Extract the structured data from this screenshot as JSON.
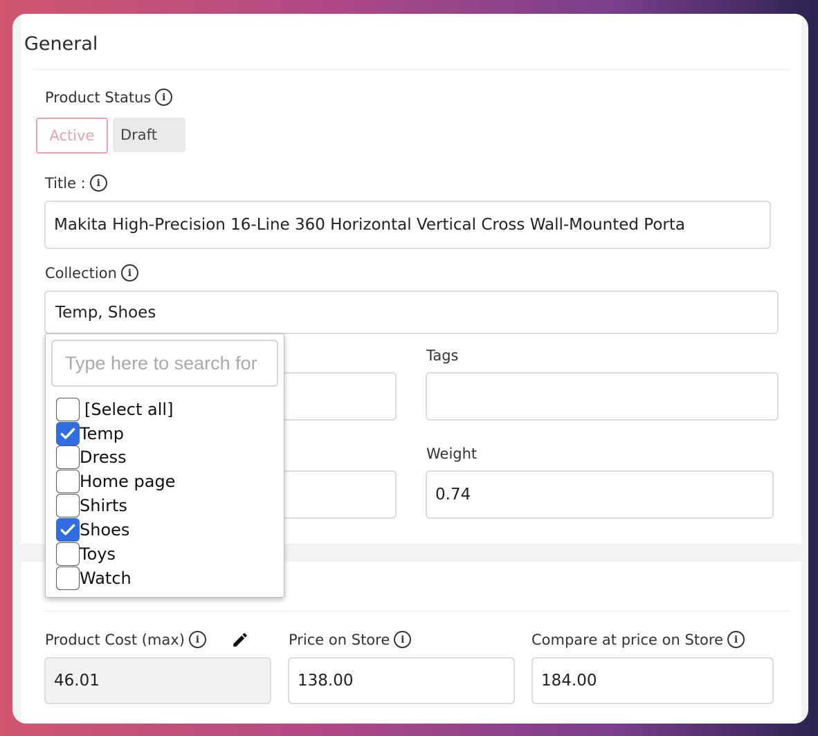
{
  "general": {
    "title": "General",
    "status": {
      "label": "Product Status",
      "active": "Active",
      "draft": "Draft"
    },
    "product_title": {
      "label": "Title :",
      "value": "Makita High-Precision 16-Line 360 Horizontal Vertical Cross Wall-Mounted Porta"
    },
    "collection": {
      "label": "Collection",
      "value": "Temp, Shoes"
    },
    "tags": {
      "label": "Tags",
      "value": ""
    },
    "weight": {
      "label": "Weight",
      "value": "0.74"
    }
  },
  "collection_dropdown": {
    "search_placeholder": "Type here to search for",
    "options": [
      {
        "label": "[Select all]",
        "checked": false
      },
      {
        "label": "Temp",
        "checked": true
      },
      {
        "label": "Dress",
        "checked": false
      },
      {
        "label": "Home page",
        "checked": false
      },
      {
        "label": "Shirts",
        "checked": false
      },
      {
        "label": "Shoes",
        "checked": true
      },
      {
        "label": "Toys",
        "checked": false
      },
      {
        "label": "Watch",
        "checked": false
      }
    ]
  },
  "pricing": {
    "cost": {
      "label": "Product Cost (max)",
      "value": "46.01"
    },
    "price": {
      "label": "Price on Store",
      "value": "138.00"
    },
    "compare": {
      "label": "Compare at price on Store",
      "value": "184.00"
    }
  },
  "colors": {
    "accent_active": "#e8a3ad",
    "checkbox_checked": "#2f6de1"
  },
  "icons": {
    "info": "info-icon",
    "edit": "pencil-icon",
    "check": "check-icon"
  }
}
